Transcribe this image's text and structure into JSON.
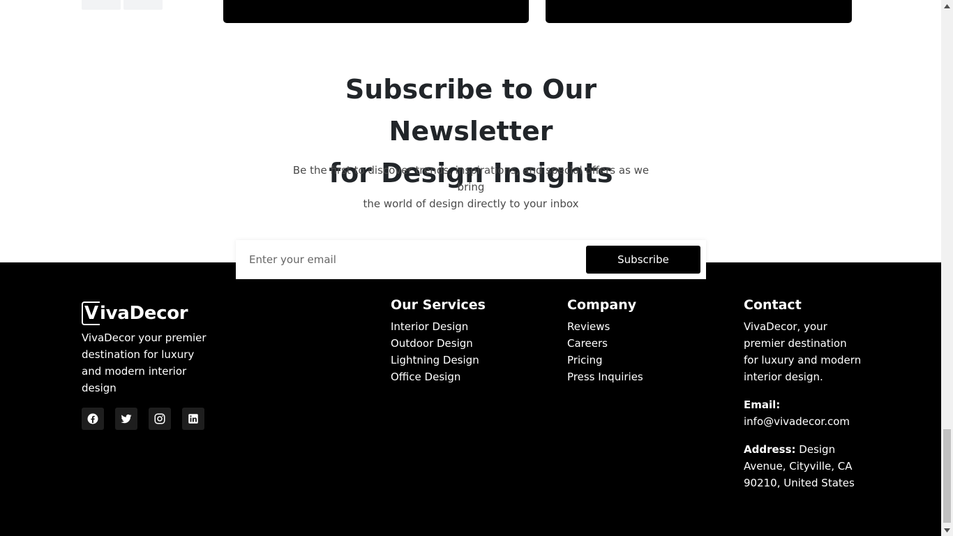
{
  "newsletter": {
    "title_line1": "Subscribe to Our Newsletter",
    "title_line2": "for Design Insights",
    "subtitle_line1": "Be the first to discover trends, inspirations, and special offers as we bring",
    "subtitle_line2": "the world of design directly to your inbox",
    "email_placeholder": "Enter your email",
    "subscribe_label": "Subscribe"
  },
  "footer": {
    "brand_initial": "V",
    "brand_rest": "ivaDecor",
    "brand_description": "VivaDecor your premier destination for luxury and modern interior design",
    "socials": [
      {
        "name": "facebook-icon"
      },
      {
        "name": "twitter-icon"
      },
      {
        "name": "instagram-icon"
      },
      {
        "name": "linkedin-icon"
      }
    ],
    "services": {
      "title": "Our Services",
      "items": [
        "Interior Design",
        "Outdoor Design",
        "Lightning Design",
        "Office Design"
      ]
    },
    "company": {
      "title": "Company",
      "items": [
        "Reviews",
        "Careers",
        "Pricing",
        "Press Inquiries"
      ]
    },
    "contact": {
      "title": "Contact",
      "description": "VivaDecor, your premier destination for luxury and modern interior design.",
      "email_label": "Email:",
      "email": "info@vivadecor.com",
      "address_label": "Address:",
      "address": "Design Avenue, Cityville, CA 90210, United States"
    }
  },
  "colors": {
    "footer_bg": "#000000",
    "button_bg": "#000000",
    "social_bg": "#1e1e1e",
    "text_light": "#ffffff",
    "text_dark": "#212529"
  }
}
